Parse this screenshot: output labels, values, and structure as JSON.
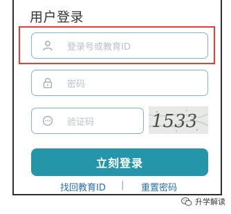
{
  "title": "用户登录",
  "fields": {
    "user_placeholder": "登录号或教育ID",
    "password_placeholder": "密码",
    "captcha_placeholder": "验证码"
  },
  "captcha": {
    "text": "1533"
  },
  "login_button": "立刻登录",
  "links": {
    "recover_id": "找回教育ID",
    "separator": "|",
    "reset_password": "重置密码"
  },
  "watermark": "升学解读",
  "colors": {
    "accent": "#2596a9",
    "field_border": "#86b0cf",
    "highlight": "#e33b36",
    "link": "#2a6fb0"
  },
  "icons": {
    "user_field": "user-icon",
    "password_field": "lock-icon",
    "captcha_field": "ellipsis-icon",
    "watermark": "wechat-icon"
  }
}
